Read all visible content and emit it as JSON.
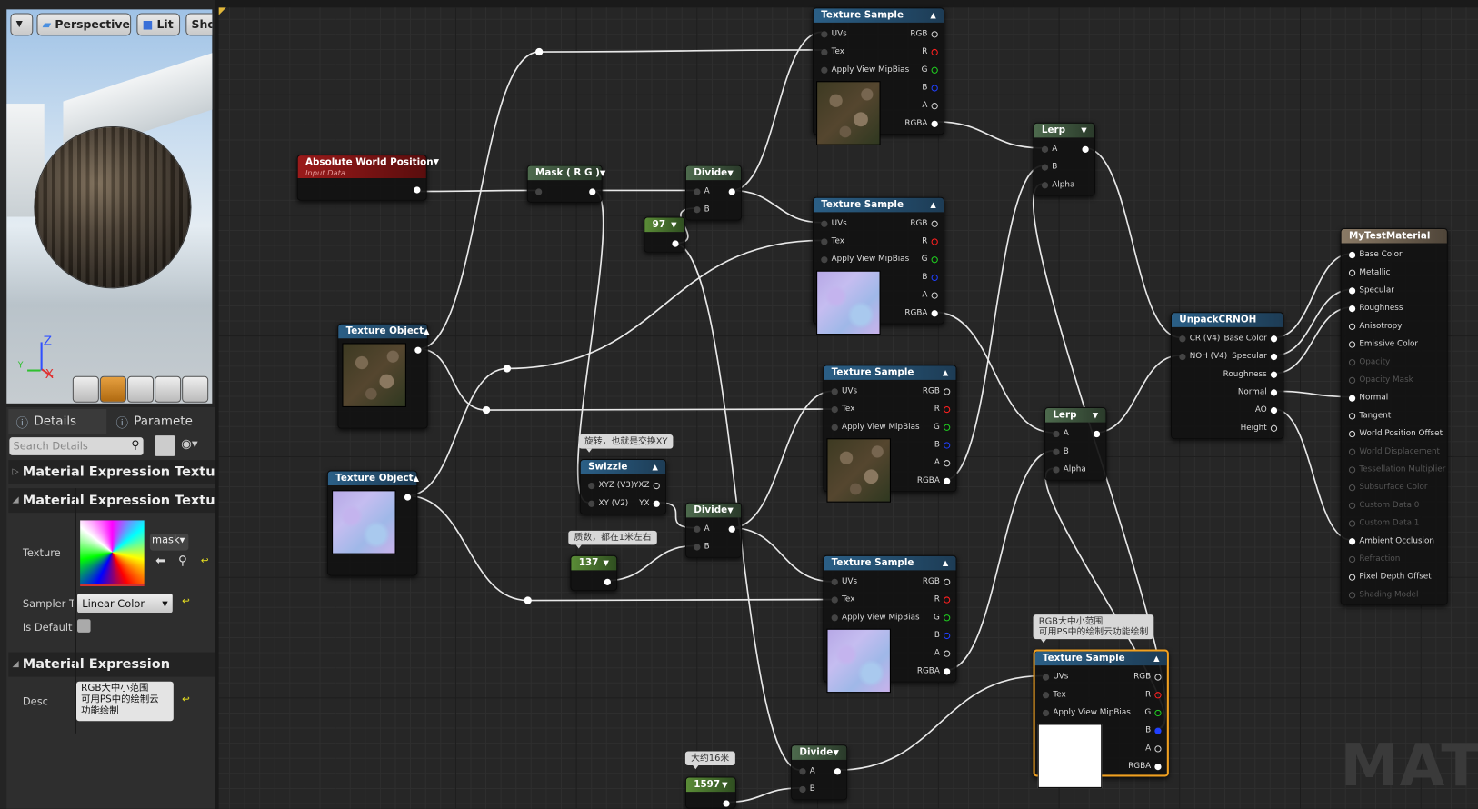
{
  "viewport": {
    "toolbar": {
      "menu_icon": "chevron-down-icon",
      "perspective": "Perspective",
      "lit": "Lit",
      "show": "Show"
    },
    "axes": {
      "z": "Z",
      "x": "X",
      "y": "Y"
    },
    "preview_shapes": [
      "cylinder",
      "sphere",
      "plane",
      "cube",
      "teapot"
    ]
  },
  "details": {
    "tabs": [
      {
        "label": "Details"
      },
      {
        "label": "Paramete"
      }
    ],
    "search_placeholder": "Search Details",
    "sections": {
      "ts": "Material Expression Texture Samp",
      "tb": "Material Expression Texture Base",
      "me": "Material Expression"
    },
    "texture_label": "Texture",
    "texture_asset": "mask",
    "sampler_label": "Sampler Ty",
    "sampler_value": "Linear Color",
    "is_default_label": "Is Default M",
    "is_default_checked": false,
    "desc_label": "Desc",
    "desc_value": "RGB大中小范围\n可用PS中的绘制云\n功能绘制"
  },
  "graph": {
    "watermark": "MATE",
    "comments": [
      {
        "id": "c1",
        "text": "旋转，也就是交换XY"
      },
      {
        "id": "c2",
        "text": "质数，都在1米左右"
      },
      {
        "id": "c3",
        "text": "大约16米"
      },
      {
        "id": "c4",
        "text": "RGB大中小范围\n可用PS中的绘制云功能绘制"
      }
    ],
    "nodes": [
      {
        "id": "ts1",
        "title": "Texture Sample",
        "color": "blue",
        "inputs": [
          "UVs",
          "Tex",
          "Apply View MipBias"
        ],
        "outputs": [
          "RGB",
          "R",
          "G",
          "B",
          "A",
          "RGBA"
        ],
        "preview": "rock"
      },
      {
        "id": "ts2",
        "title": "Texture Sample",
        "color": "blue",
        "inputs": [
          "UVs",
          "Tex",
          "Apply View MipBias"
        ],
        "outputs": [
          "RGB",
          "R",
          "G",
          "B",
          "A",
          "RGBA"
        ],
        "preview": "nrm"
      },
      {
        "id": "ts3",
        "title": "Texture Sample",
        "color": "blue",
        "inputs": [
          "UVs",
          "Tex",
          "Apply View MipBias"
        ],
        "outputs": [
          "RGB",
          "R",
          "G",
          "B",
          "A",
          "RGBA"
        ],
        "preview": "rock"
      },
      {
        "id": "ts4",
        "title": "Texture Sample",
        "color": "blue",
        "inputs": [
          "UVs",
          "Tex",
          "Apply View MipBias"
        ],
        "outputs": [
          "RGB",
          "R",
          "G",
          "B",
          "A",
          "RGBA"
        ],
        "preview": "nrm"
      },
      {
        "id": "ts5",
        "title": "Texture Sample",
        "color": "blue",
        "selected": true,
        "inputs": [
          "UVs",
          "Tex",
          "Apply View MipBias"
        ],
        "outputs": [
          "RGB",
          "R",
          "G",
          "B",
          "A",
          "RGBA"
        ],
        "preview": "white"
      },
      {
        "id": "awp",
        "title": "Absolute World Position",
        "subtitle": "Input Data",
        "color": "red",
        "inputs": [],
        "outputs": [
          ""
        ]
      },
      {
        "id": "mask",
        "title": "Mask ( R G )",
        "color": "gray",
        "inputs": [
          ""
        ],
        "outputs": [
          ""
        ]
      },
      {
        "id": "div1",
        "title": "Divide",
        "color": "gray",
        "inputs": [
          "A",
          "B"
        ],
        "outputs": [
          ""
        ]
      },
      {
        "id": "c97",
        "title": "97",
        "color": "green",
        "inputs": [],
        "outputs": [
          ""
        ]
      },
      {
        "id": "to1",
        "title": "Texture Object",
        "color": "blue",
        "inputs": [],
        "outputs": [
          ""
        ],
        "preview": "rock"
      },
      {
        "id": "to2",
        "title": "Texture Object",
        "color": "blue",
        "inputs": [],
        "outputs": [
          ""
        ],
        "preview": "nrm"
      },
      {
        "id": "swz",
        "title": "Swizzle",
        "color": "blue",
        "inputs": [
          "XYZ (V3)",
          "XY (V2)"
        ],
        "outputs": [
          "YXZ",
          "YX"
        ]
      },
      {
        "id": "div2",
        "title": "Divide",
        "color": "gray",
        "inputs": [
          "A",
          "B"
        ],
        "outputs": [
          ""
        ]
      },
      {
        "id": "c137",
        "title": "137",
        "color": "green",
        "inputs": [],
        "outputs": [
          ""
        ]
      },
      {
        "id": "div3",
        "title": "Divide",
        "color": "gray",
        "inputs": [
          "A",
          "B"
        ],
        "outputs": [
          ""
        ]
      },
      {
        "id": "c1597",
        "title": "1597",
        "color": "green",
        "inputs": [],
        "outputs": [
          ""
        ]
      },
      {
        "id": "lerp1",
        "title": "Lerp",
        "color": "gray",
        "inputs": [
          "A",
          "B",
          "Alpha"
        ],
        "outputs": [
          ""
        ]
      },
      {
        "id": "lerp2",
        "title": "Lerp",
        "color": "gray",
        "inputs": [
          "A",
          "B",
          "Alpha"
        ],
        "outputs": [
          ""
        ]
      },
      {
        "id": "unpack",
        "title": "UnpackCRNOH",
        "color": "blue",
        "inputs": [
          "CR (V4)",
          "NOH (V4)"
        ],
        "outputs": [
          "Base Color",
          "Specular",
          "Roughness",
          "Normal",
          "AO",
          "Height"
        ]
      },
      {
        "id": "mat",
        "title": "MyTestMaterial",
        "color": "brown",
        "inputs": [
          "Base Color",
          "Metallic",
          "Specular",
          "Roughness",
          "Anisotropy",
          "Emissive Color",
          "Opacity",
          "Opacity Mask",
          "Normal",
          "Tangent",
          "World Position Offset",
          "World Displacement",
          "Tessellation Multiplier",
          "Subsurface Color",
          "Custom Data 0",
          "Custom Data 1",
          "Ambient Occlusion",
          "Refraction",
          "Pixel Depth Offset",
          "Shading Model"
        ],
        "disabled_inputs": [
          "Opacity",
          "Opacity Mask",
          "World Displacement",
          "Tessellation Multiplier",
          "Subsurface Color",
          "Custom Data 0",
          "Custom Data 1",
          "Refraction",
          "Shading Model"
        ],
        "connected_inputs": [
          "Base Color",
          "Specular",
          "Roughness",
          "Normal",
          "Ambient Occlusion"
        ],
        "outputs": []
      }
    ],
    "pin_colors": {
      "R": "#ff2020",
      "G": "#20d020",
      "B": "#2040ff",
      "default": "#d0d0d0"
    }
  }
}
